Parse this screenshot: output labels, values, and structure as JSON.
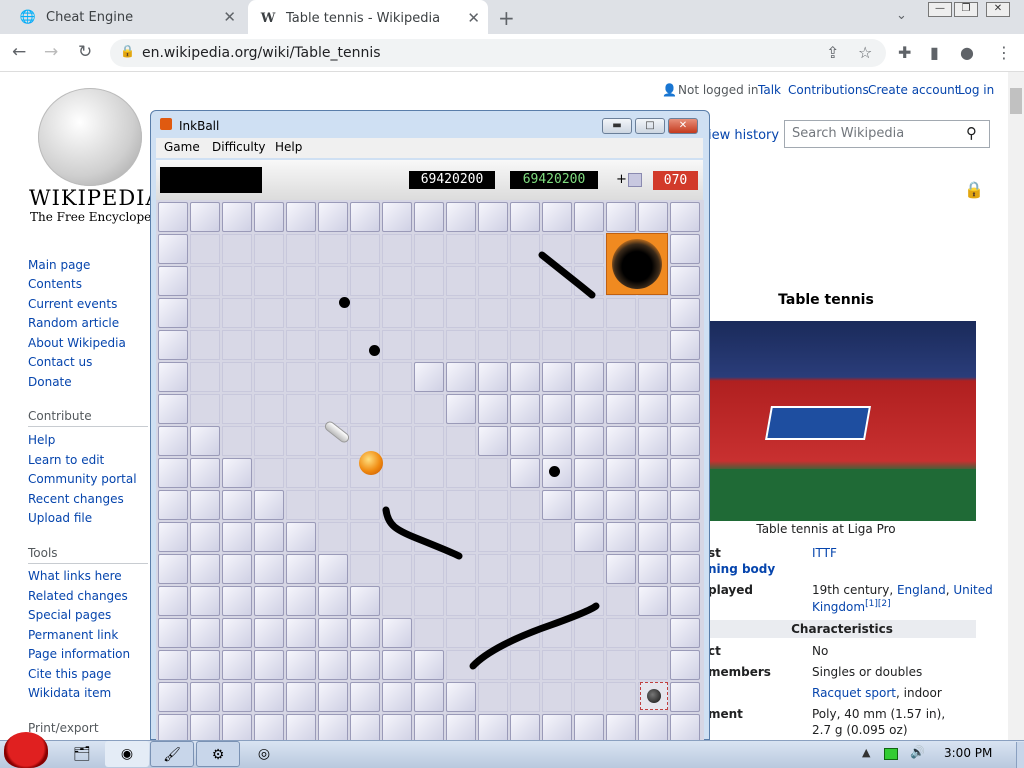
{
  "browser": {
    "tabs": [
      {
        "title": "Cheat Engine",
        "icon": "globe-icon"
      },
      {
        "title": "Table tennis - Wikipedia",
        "icon": "wikipedia-w-icon"
      }
    ],
    "url": "en.wikipedia.org/wiki/Table_tennis"
  },
  "wiki": {
    "logo_wordmark": "WIKIPEDIA",
    "logo_tagline": "The Free Encyclopedia",
    "user_links": [
      "Not logged in",
      "Talk",
      "Contributions",
      "Create account",
      "Log in"
    ],
    "view_history": "iew history",
    "search_placeholder": "Search Wikipedia",
    "nav": [
      "Main page",
      "Contents",
      "Current events",
      "Random article",
      "About Wikipedia",
      "Contact us",
      "Donate"
    ],
    "contribute_heading": "Contribute",
    "contribute": [
      "Help",
      "Learn to edit",
      "Community portal",
      "Recent changes",
      "Upload file"
    ],
    "tools_heading": "Tools",
    "tools": [
      "What links here",
      "Related changes",
      "Special pages",
      "Permanent link",
      "Page information",
      "Cite this page",
      "Wikidata item"
    ],
    "print_heading": "Print/export",
    "infobox": {
      "title": "Table tennis",
      "caption": "Table tennis at Liga Pro",
      "rows": [
        {
          "label": "st",
          "value": "ITTF",
          "value_link": true
        },
        {
          "label": "ning body",
          "value": "",
          "label_link": true
        },
        {
          "label": "played",
          "value": "19th century, ",
          "links": [
            "England",
            "United"
          ]
        },
        {
          "label": "",
          "value": "",
          "links": [
            "Kingdom"
          ],
          "refs": "[1][2]"
        },
        {
          "label": "ct",
          "value": "No"
        },
        {
          "label": "members",
          "value": "Singles or doubles"
        },
        {
          "label": "",
          "value": ", indoor",
          "links": [
            "Racquet sport"
          ]
        },
        {
          "label": "ment",
          "value": "Poly, 40 mm (1.57 in),"
        },
        {
          "label": "",
          "value": "2.7 g (0.095 oz)"
        }
      ],
      "characteristics_heading": "Characteristics"
    }
  },
  "inkball": {
    "title": "InkBall",
    "menu": [
      "Game",
      "Difficulty",
      "Help"
    ],
    "score": "69420200",
    "high_score": "69420200",
    "plus": "+",
    "timer": "070"
  },
  "taskbar": {
    "clock": "3:00 PM"
  }
}
